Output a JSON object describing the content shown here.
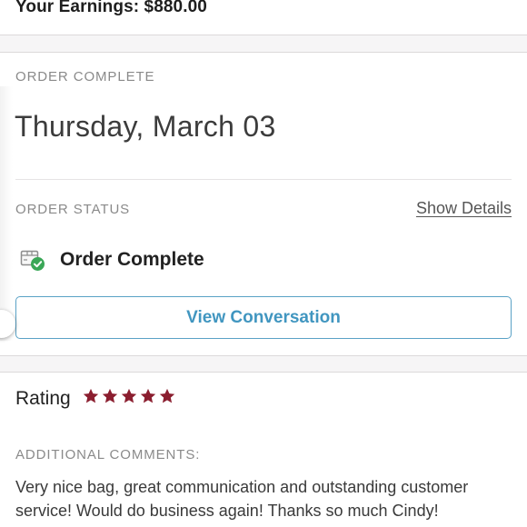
{
  "earnings": {
    "text": "Your Earnings: $880.00"
  },
  "order": {
    "section_label": "ORDER COMPLETE",
    "date": "Thursday, March 03",
    "status_label": "ORDER STATUS",
    "show_details_label": "Show Details",
    "status_text": "Order Complete",
    "status_icon": "package-check-icon",
    "view_conversation_label": "View Conversation"
  },
  "rating": {
    "label": "Rating",
    "stars": 5,
    "star_color": "#8b1e2f",
    "comments_label": "ADDITIONAL COMMENTS:",
    "comment": "Very nice bag, great communication and outstanding customer service! Would do business again! Thanks so much Cindy!"
  },
  "colors": {
    "accent": "#4196c0",
    "success": "#3aa757",
    "star": "#8b1e2f"
  }
}
